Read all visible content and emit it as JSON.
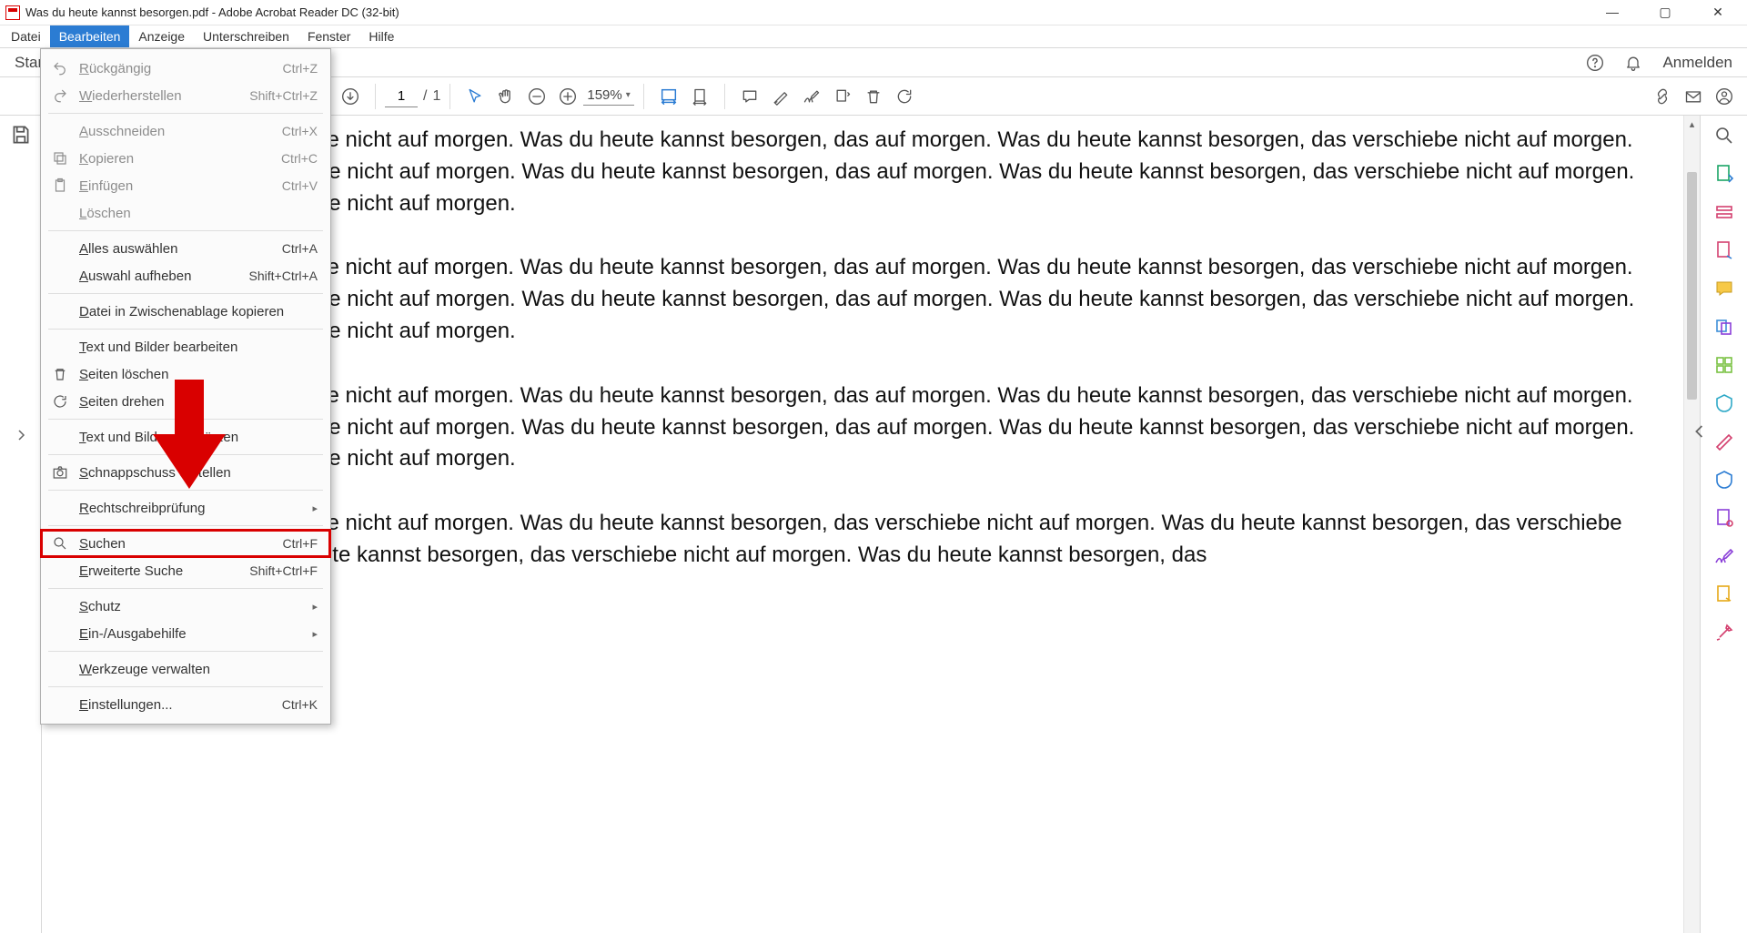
{
  "window": {
    "title": "Was du heute kannst besorgen.pdf - Adobe Acrobat Reader DC (32-bit)"
  },
  "menubar": [
    "Datei",
    "Bearbeiten",
    "Anzeige",
    "Unterschreiben",
    "Fenster",
    "Hilfe"
  ],
  "menubar_active_index": 1,
  "topstrip": {
    "start": "Star",
    "signin": "Anmelden"
  },
  "toolbar": {
    "page_current": "1",
    "page_total": "1",
    "page_sep": "/",
    "zoom": "159%"
  },
  "dropdown": {
    "items": [
      {
        "type": "item",
        "label": "Rückgängig",
        "shortcut": "Ctrl+Z",
        "disabled": true,
        "icon": "undo"
      },
      {
        "type": "item",
        "label": "Wiederherstellen",
        "shortcut": "Shift+Ctrl+Z",
        "disabled": true,
        "icon": "redo"
      },
      {
        "type": "sep"
      },
      {
        "type": "item",
        "label": "Ausschneiden",
        "shortcut": "Ctrl+X",
        "disabled": true
      },
      {
        "type": "item",
        "label": "Kopieren",
        "shortcut": "Ctrl+C",
        "disabled": true,
        "icon": "copy"
      },
      {
        "type": "item",
        "label": "Einfügen",
        "shortcut": "Ctrl+V",
        "disabled": true,
        "icon": "paste"
      },
      {
        "type": "item",
        "label": "Löschen",
        "disabled": true
      },
      {
        "type": "sep"
      },
      {
        "type": "item",
        "label": "Alles auswählen",
        "shortcut": "Ctrl+A"
      },
      {
        "type": "item",
        "label": "Auswahl aufheben",
        "shortcut": "Shift+Ctrl+A"
      },
      {
        "type": "sep"
      },
      {
        "type": "item",
        "label": "Datei in Zwischenablage kopieren"
      },
      {
        "type": "sep"
      },
      {
        "type": "item",
        "label": "Text und Bilder bearbeiten"
      },
      {
        "type": "item",
        "label": "Seiten löschen",
        "icon": "trash"
      },
      {
        "type": "item",
        "label": "Seiten drehen",
        "icon": "rotate"
      },
      {
        "type": "sep"
      },
      {
        "type": "item",
        "label": "Text und Bilder schwärzen"
      },
      {
        "type": "sep"
      },
      {
        "type": "item",
        "label": "Schnappschuss erstellen",
        "icon": "camera"
      },
      {
        "type": "sep"
      },
      {
        "type": "item",
        "label": "Rechtschreibprüfung",
        "submenu": true
      },
      {
        "type": "sep"
      },
      {
        "type": "item",
        "label": "Suchen",
        "shortcut": "Ctrl+F",
        "icon": "search",
        "highlight": true
      },
      {
        "type": "item",
        "label": "Erweiterte Suche",
        "shortcut": "Shift+Ctrl+F"
      },
      {
        "type": "sep"
      },
      {
        "type": "item",
        "label": "Schutz",
        "submenu": true
      },
      {
        "type": "item",
        "label": "Ein-/Ausgabehilfe",
        "submenu": true
      },
      {
        "type": "sep"
      },
      {
        "type": "item",
        "label": "Werkzeuge verwalten"
      },
      {
        "type": "sep"
      },
      {
        "type": "item",
        "label": "Einstellungen...",
        "shortcut": "Ctrl+K"
      }
    ]
  },
  "document": {
    "paragraphs": [
      "nnst besorgen, das verschiebe nicht auf morgen. Was du heute kannst besorgen, das auf morgen. Was du heute kannst besorgen, das verschiebe nicht auf morgen. Was besorgen, das verschiebe nicht auf morgen. Was du heute kannst besorgen, das auf morgen. Was du heute kannst besorgen, das verschiebe nicht auf morgen. Was besorgen, das verschiebe nicht auf morgen.",
      "nnst besorgen, das verschiebe nicht auf morgen. Was du heute kannst besorgen, das auf morgen. Was du heute kannst besorgen, das verschiebe nicht auf morgen. Was besorgen, das verschiebe nicht auf morgen. Was du heute kannst besorgen, das auf morgen. Was du heute kannst besorgen, das verschiebe nicht auf morgen. Was besorgen, das verschiebe nicht auf morgen.",
      "nnst besorgen, das verschiebe nicht auf morgen. Was du heute kannst besorgen, das auf morgen. Was du heute kannst besorgen, das verschiebe nicht auf morgen. Was besorgen, das verschiebe nicht auf morgen. Was du heute kannst besorgen, das auf morgen. Was du heute kannst besorgen, das verschiebe nicht auf morgen. Was besorgen, das verschiebe nicht auf morgen.",
      "nnst besorgen, das verschiebe nicht auf morgen. Was du heute kannst besorgen, das verschiebe nicht auf morgen. Was du heute kannst besorgen, das verschiebe nicht auf morgen. Was du heute kannst besorgen, das verschiebe nicht auf morgen. Was du heute kannst besorgen, das"
    ]
  },
  "annotation": {
    "highlight_label": "Suchen (Ctrl+F)"
  }
}
